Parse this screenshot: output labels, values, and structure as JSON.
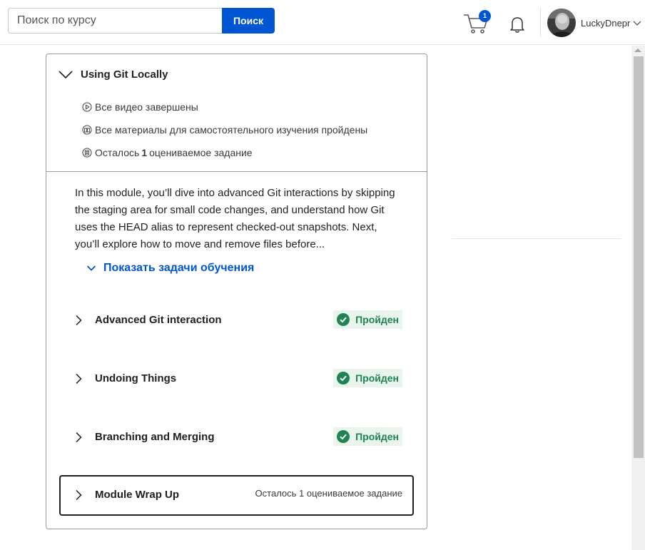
{
  "search": {
    "placeholder": "Поиск по курсу",
    "button_label": "Поиск"
  },
  "header": {
    "cart_count": "1",
    "username": "LuckyDnepr"
  },
  "module": {
    "title": "Using Git Locally",
    "stats": {
      "videos": "Все видео завершены",
      "readings": "Все материалы для самостоятельного изучения пройдены",
      "graded_prefix": "Осталось",
      "graded_count": "1",
      "graded_suffix": "оцениваемое задание"
    },
    "description": "In this module, you’ll dive into advanced Git interactions by skipping the staging area for small code changes, and understand how Git uses the HEAD alias to represent checked-out snapshots. Next, you’ll explore how to move and remove files before...",
    "show_goals_label": "Показать задачи обучения",
    "lessons": [
      {
        "title": "Advanced Git interaction",
        "status": "Пройден"
      },
      {
        "title": "Undoing Things",
        "status": "Пройден"
      },
      {
        "title": "Branching and Merging",
        "status": "Пройден"
      },
      {
        "title": "Module Wrap Up",
        "status": "Осталось 1 оцениваемое задание"
      }
    ]
  },
  "colors": {
    "accent": "#0056d2",
    "success": "#1f8354",
    "success_bg": "#e8f4ec"
  },
  "icons": [
    "cart-icon",
    "bell-icon",
    "chevron-down-icon",
    "play-circle-icon",
    "reading-icon",
    "assignment-icon",
    "chevron-right-icon",
    "check-circle-icon"
  ]
}
